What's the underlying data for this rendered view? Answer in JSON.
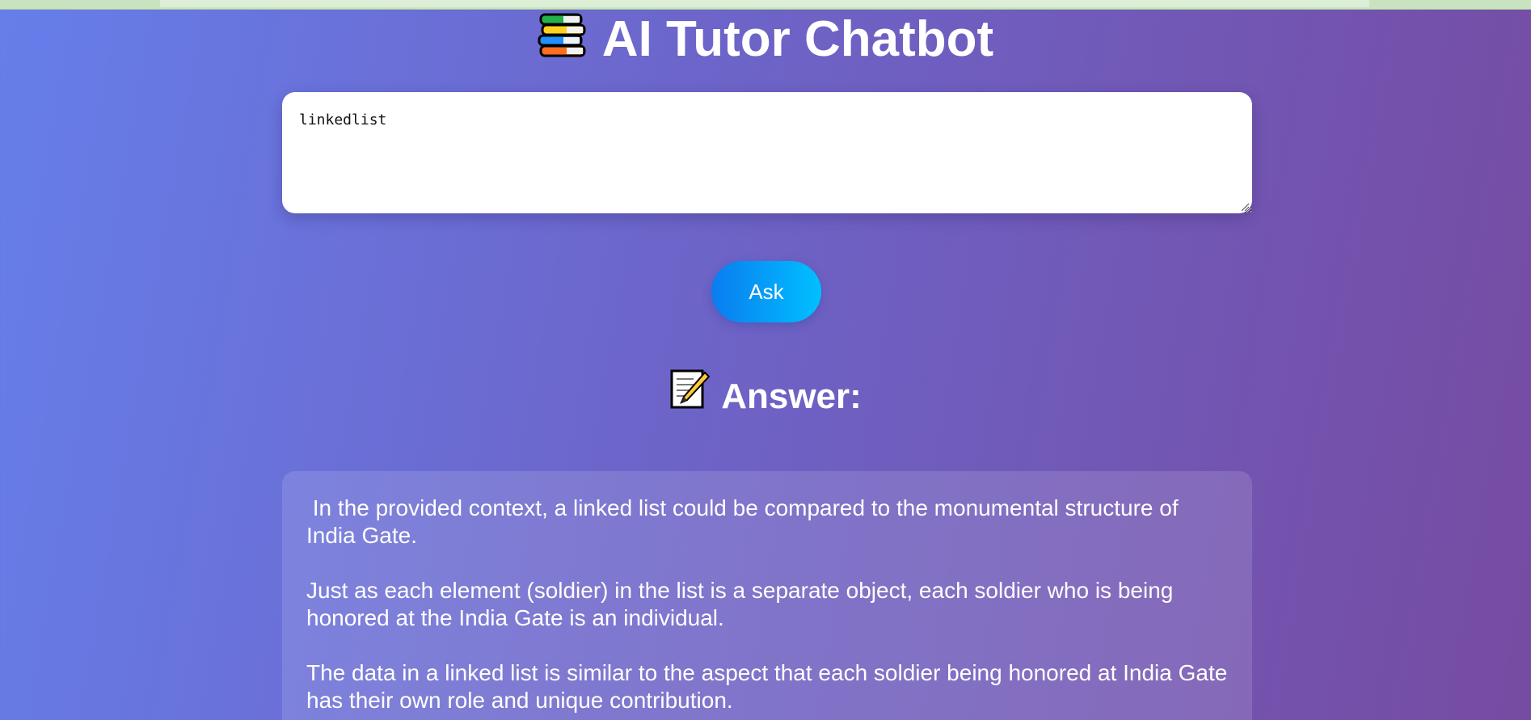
{
  "page": {
    "title": "AI Tutor Chatbot",
    "title_icon": "books-icon"
  },
  "question": {
    "value": "linkedlist"
  },
  "ask_button": {
    "label": "Ask"
  },
  "answer": {
    "heading": "Answer:",
    "heading_icon": "memo-icon",
    "paragraphs": [
      " In the provided context, a linked list could be compared to the monumental structure of India Gate.",
      "Just as each element (soldier) in the list is a separate object, each soldier who is being honored at the India Gate is an individual.",
      "The data in a linked list is similar to the aspect that each soldier being honored at India Gate has their own role and unique contribution."
    ]
  },
  "colors": {
    "background_start": "#667eea",
    "background_end": "#764ba2",
    "button_start": "#0a7cf0",
    "button_end": "#00c0ff",
    "text": "#ffffff"
  }
}
